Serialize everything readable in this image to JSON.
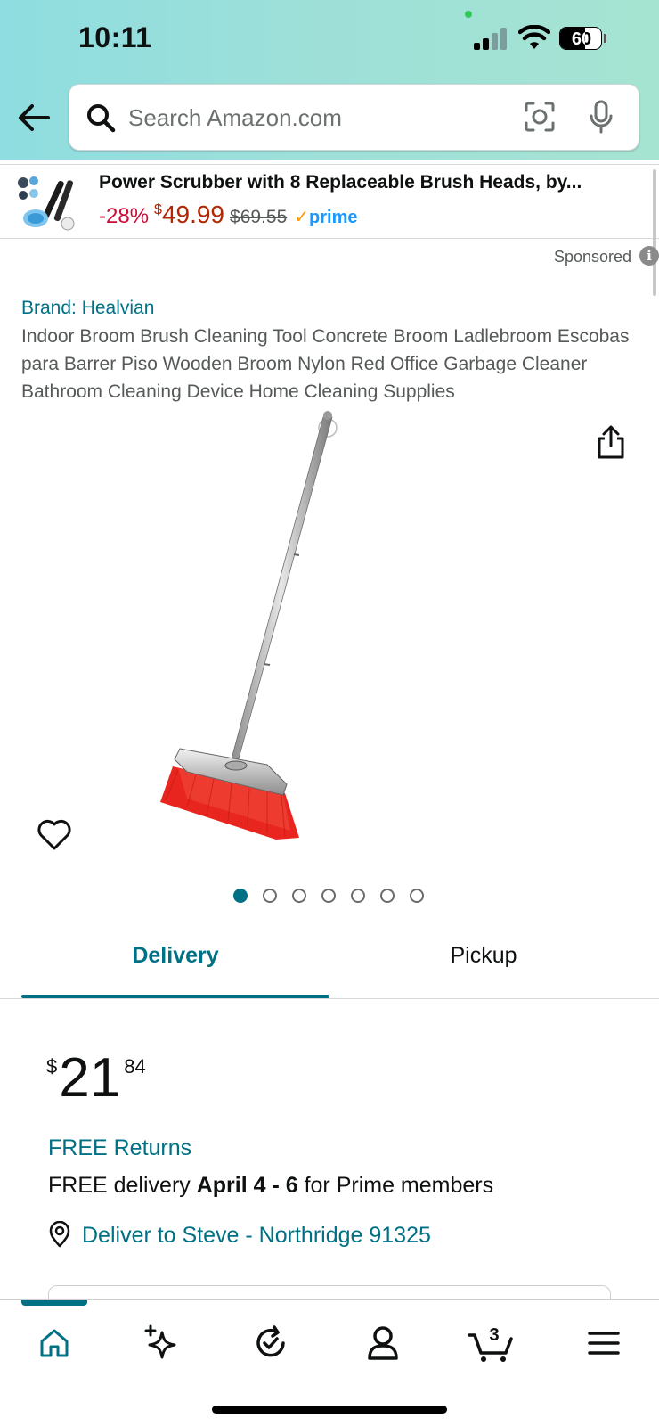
{
  "status_bar": {
    "time": "10:11",
    "battery": "60",
    "battery_level": 0.6
  },
  "search": {
    "placeholder": "Search Amazon.com"
  },
  "sponsored_banner": {
    "title": "Power Scrubber with 8 Replaceable Brush Heads, by...",
    "discount": "-28%",
    "currency": "$",
    "price": "49.99",
    "list_price": "$69.55",
    "prime_check": "✓",
    "prime": "prime",
    "sponsored_label": "Sponsored",
    "info_glyph": "i"
  },
  "product": {
    "brand": "Brand: Healvian",
    "title": "Indoor Broom Brush Cleaning Tool Concrete Broom Ladlebroom Escobas para Barrer Piso Wooden Broom Nylon Red Office Garbage Cleaner Bathroom Cleaning Device Home Cleaning Supplies",
    "image_count": 7,
    "active_image": 0
  },
  "tabs": {
    "delivery": "Delivery",
    "pickup": "Pickup",
    "active": "delivery"
  },
  "pricing": {
    "currency": "$",
    "whole": "21",
    "fraction": "84",
    "free_returns": "FREE Returns",
    "delivery_prefix": "FREE delivery ",
    "delivery_dates": "April 4 - 6",
    "delivery_suffix": " for Prime members",
    "deliver_to": "Deliver to Steve - Northridge 91325"
  },
  "bottom_nav": {
    "cart_count": "3",
    "items": [
      "home-icon",
      "rufus-sparkle-icon",
      "buy-again-icon",
      "account-icon",
      "cart-icon",
      "menu-icon"
    ],
    "active": "home-icon"
  },
  "colors": {
    "accent_teal": "#007185",
    "price_red": "#b12704",
    "discount_red": "#cc0c39",
    "prime_blue": "#1a98ff",
    "broom_red": "#e8261f"
  }
}
